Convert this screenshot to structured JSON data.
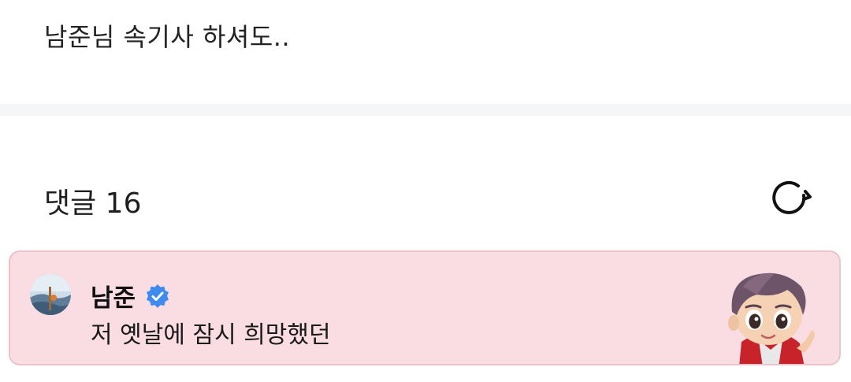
{
  "post": {
    "text": "남준님 속기사 하셔도.."
  },
  "comments": {
    "title": "댓글 16",
    "refresh_icon": "refresh-icon"
  },
  "pinned_comment": {
    "author": "남준",
    "verified": true,
    "text": "저 옛날에 잠시 희망했던",
    "background": "#fadce3",
    "border": "#eac3cd",
    "verified_color": "#3d8bf0"
  }
}
